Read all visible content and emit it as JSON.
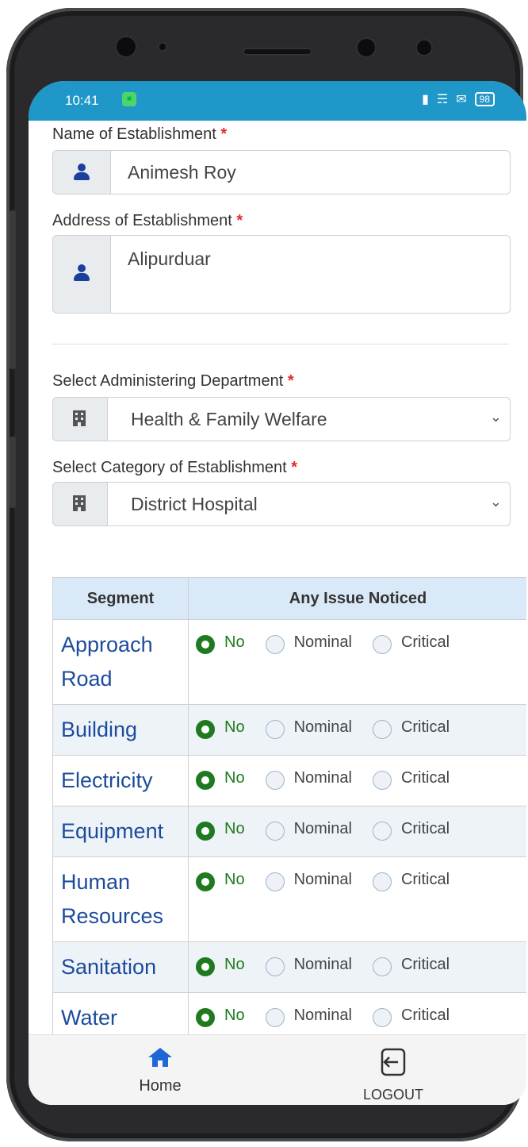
{
  "status_bar": {
    "time": "10:41",
    "battery": "98"
  },
  "form": {
    "name_label": "Name of Establishment",
    "name_value": "Animesh Roy",
    "address_label": "Address of Establishment",
    "address_value": "Alipurduar",
    "required_mark": "*",
    "department_label": "Select Administering Department",
    "department_value": "Health & Family Welfare",
    "category_label": "Select Category of Establishment",
    "category_value": "District Hospital"
  },
  "table": {
    "col_segment": "Segment",
    "col_issue": "Any Issue Noticed",
    "options": [
      "No",
      "Nominal",
      "Critical"
    ],
    "rows": [
      {
        "segment": "Approach Road",
        "selected": "No"
      },
      {
        "segment": "Building",
        "selected": "No"
      },
      {
        "segment": "Electricity",
        "selected": "No"
      },
      {
        "segment": "Equipment",
        "selected": "No"
      },
      {
        "segment": "Human Resources",
        "selected": "No"
      },
      {
        "segment": "Sanitation",
        "selected": "No"
      },
      {
        "segment": "Water",
        "selected": "No"
      }
    ]
  },
  "bottom_nav": {
    "home_label": "Home",
    "logout_label": "LOGOUT"
  },
  "colors": {
    "accent": "#1f98c9",
    "selected": "#1f7a1f",
    "segment_text": "#1d4b9c",
    "required": "#e32b2b"
  }
}
